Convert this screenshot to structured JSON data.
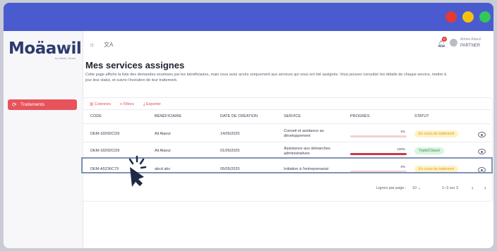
{
  "colors": {
    "accent": "#e8535b",
    "titlebar": "#4a5bd0",
    "close": "#e53935",
    "minimize": "#f4c20d",
    "maximize": "#34c759"
  },
  "brand": {
    "logo": "Moäawil",
    "logo_sub": "by Mashi, Jeune"
  },
  "topbar": {
    "icons": [
      "sun-icon",
      "translate-icon"
    ],
    "notification_count": "0",
    "user_name": "Amine Alaoui",
    "user_role": "PARTNER"
  },
  "sidebar": {
    "items": [
      {
        "label": "Traitements",
        "icon": "refresh-icon",
        "active": true
      }
    ]
  },
  "page": {
    "title": "Mes services assignes",
    "description": "Cette page affiche la liste des demandes soumises par les bénéficiaires, mais vous avez accès uniquement aux services qui vous ont été assignés. Vous pouvez consulter les détails de chaque service, mettre à jour leur statut, et suivre l'évolution de leur traitement."
  },
  "toolbar": {
    "columns": "Colonnes",
    "filters": "Filtres",
    "export": "Exporter"
  },
  "table": {
    "headers": [
      "CODE",
      "BÉNÉFICIAIRE",
      "DATE DE CRÉATION",
      "SERVICE",
      "PROGRÈS",
      "STATUT"
    ],
    "rows": [
      {
        "code": "DEM-1820DCD9",
        "beneficiary": "Ali Alaoui",
        "date": "14/05/2025",
        "service": "Conseil et assitance au développement",
        "progress": 0,
        "progress_label": "0%",
        "status": "En cours de traitement"
      },
      {
        "code": "DEM-1820DCD9",
        "beneficiary": "Ali Alaoui",
        "date": "01/05/2025",
        "service": "Assistance aux démarches administratives",
        "progress": 100,
        "progress_label": "100%",
        "status": "Traité/Cloturé"
      },
      {
        "code": "DEM-A5236C79",
        "beneficiary": "abcd abc",
        "date": "05/05/2025",
        "service": "Initiation à l'entreprenariat",
        "progress": 0,
        "progress_label": "0%",
        "status": "En cours de traitement"
      }
    ]
  },
  "pagination": {
    "rows_per_page_label": "Lignes par page :",
    "rows_per_page": "10",
    "range": "1–3 sur 3"
  }
}
